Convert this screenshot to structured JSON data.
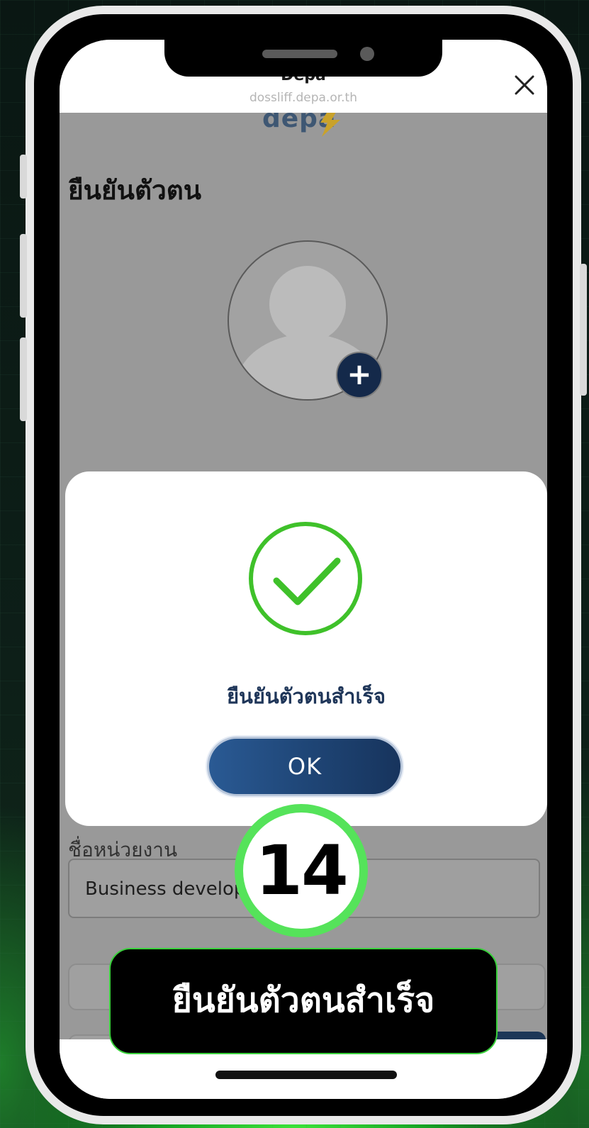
{
  "browser": {
    "site_title": "Depa",
    "site_url": "dossliff.depa.or.th"
  },
  "page": {
    "logo_text": "depa",
    "heading": "ยืนยันตัวตน",
    "unit_label": "ชื่อหน่วยงาน",
    "unit_value": "Business develop"
  },
  "modal": {
    "message": "ยืนยันตัวตนสำเร็จ",
    "ok_label": "OK"
  },
  "overlay": {
    "step_number": "14",
    "caption": "ยืนยันตัวตนสำเร็จ"
  },
  "colors": {
    "accent_green": "#55e35a",
    "check_green": "#3fc12a",
    "button_navy": "#1f4677"
  },
  "icons": [
    "close-icon",
    "add-photo-icon",
    "check-circle-icon",
    "avatar-placeholder-icon"
  ]
}
